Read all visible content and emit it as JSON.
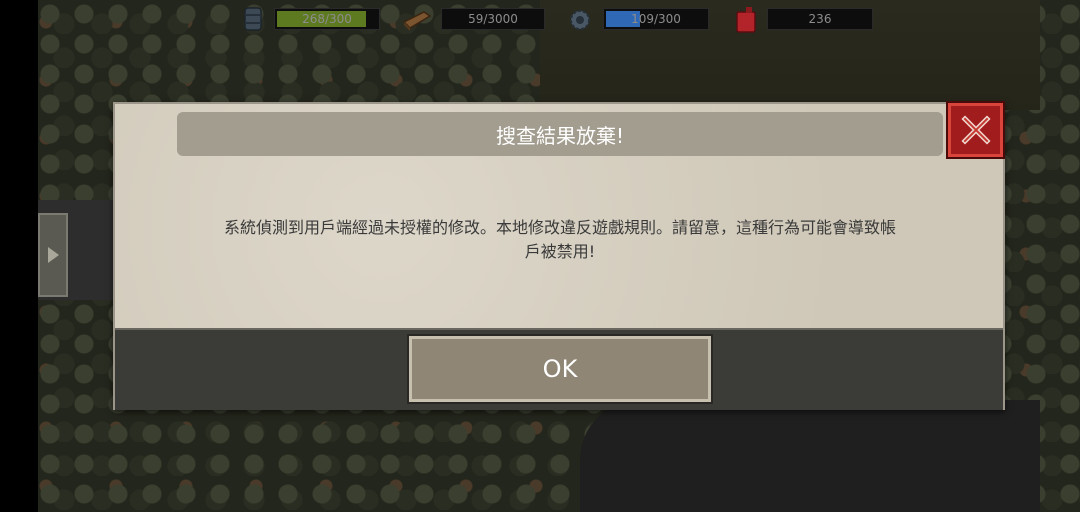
{
  "hud": {
    "fuel": {
      "value": "268/300",
      "fill": 0.893,
      "icon": "fuel-barrel-icon",
      "color": "#6f8a2a"
    },
    "wood": {
      "value": "59/3000",
      "fill": 0.02,
      "icon": "wood-plank-icon",
      "color": "#6b4a2a"
    },
    "parts": {
      "value": "109/300",
      "fill": 0.363,
      "icon": "gear-icon",
      "color": "#3f7fd0"
    },
    "gas": {
      "value": "236",
      "icon": "gas-can-icon",
      "color": "#c0282a"
    }
  },
  "dialog": {
    "title": "搜查結果放棄!",
    "message_line1": "系統偵測到用戶端經過未授權的修改。本地修改違反遊戲規則。請留意，這種行為可能會導致帳",
    "message_line2": "戶被禁用!",
    "ok_label": "OK",
    "close_icon": "close-icon"
  }
}
